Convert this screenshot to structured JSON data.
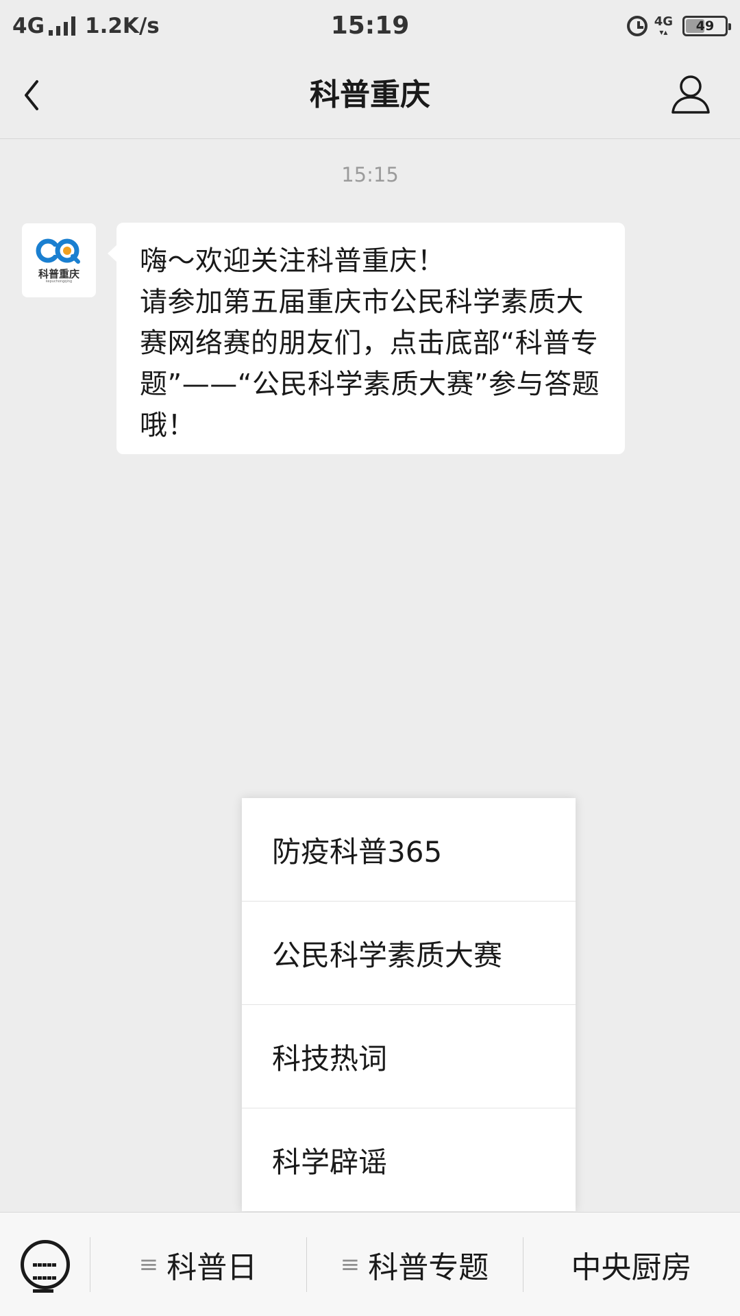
{
  "status_bar": {
    "network": "4G",
    "speed": "1.2K/s",
    "time": "15:19",
    "network_right": "4G",
    "battery": "49",
    "battery_fraction": 0.49
  },
  "nav": {
    "title": "科普重庆"
  },
  "chat": {
    "timestamp": "15:15",
    "avatar_caption": "科普重庆",
    "avatar_sub": "kepuchongqing",
    "message": "嗨～欢迎关注科普重庆！\n请参加第五届重庆市公民科学素质大赛网络赛的朋友们，点击底部“科普专题”——“公民科学素质大赛”参与答题哦！"
  },
  "popup_menu": {
    "items": [
      "防疫科普365",
      "公民科学素质大赛",
      "科技热词",
      "科学辟谣"
    ]
  },
  "menu_bar": {
    "hamburger": "≡",
    "tabs": [
      "科普日",
      "科普专题",
      "中央厨房"
    ]
  },
  "colors": {
    "background": "#ededed",
    "bubble": "#ffffff",
    "logo_blue": "#1a7fd0",
    "logo_orange": "#f0a020"
  }
}
